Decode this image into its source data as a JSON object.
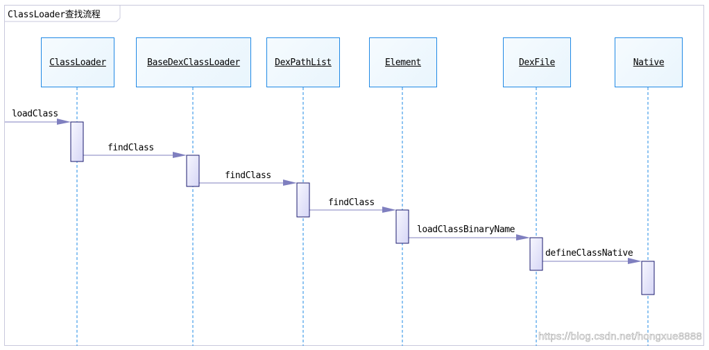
{
  "diagram": {
    "title": "ClassLoader查找流程",
    "type": "sequence",
    "participants": [
      {
        "name": "ClassLoader"
      },
      {
        "name": "BaseDexClassLoader"
      },
      {
        "name": "DexPathList"
      },
      {
        "name": "Element"
      },
      {
        "name": "DexFile"
      },
      {
        "name": "Native"
      }
    ],
    "messages": [
      {
        "label": "loadClass",
        "from": "external",
        "to": "ClassLoader"
      },
      {
        "label": "findClass",
        "from": "ClassLoader",
        "to": "BaseDexClassLoader"
      },
      {
        "label": "findClass",
        "from": "BaseDexClassLoader",
        "to": "DexPathList"
      },
      {
        "label": "findClass",
        "from": "DexPathList",
        "to": "Element"
      },
      {
        "label": "loadClassBinaryName",
        "from": "Element",
        "to": "DexFile"
      },
      {
        "label": "defineClassNative",
        "from": "DexFile",
        "to": "Native"
      }
    ],
    "colors": {
      "box_border": "#1e88e5",
      "lifeline": "#1e88e5",
      "message_line": "#7f7fbf",
      "activation_border": "#1a1a6e",
      "frame_border": "#c8c8dc"
    }
  },
  "watermark": "https://blog.csdn.net/hongxue8888"
}
